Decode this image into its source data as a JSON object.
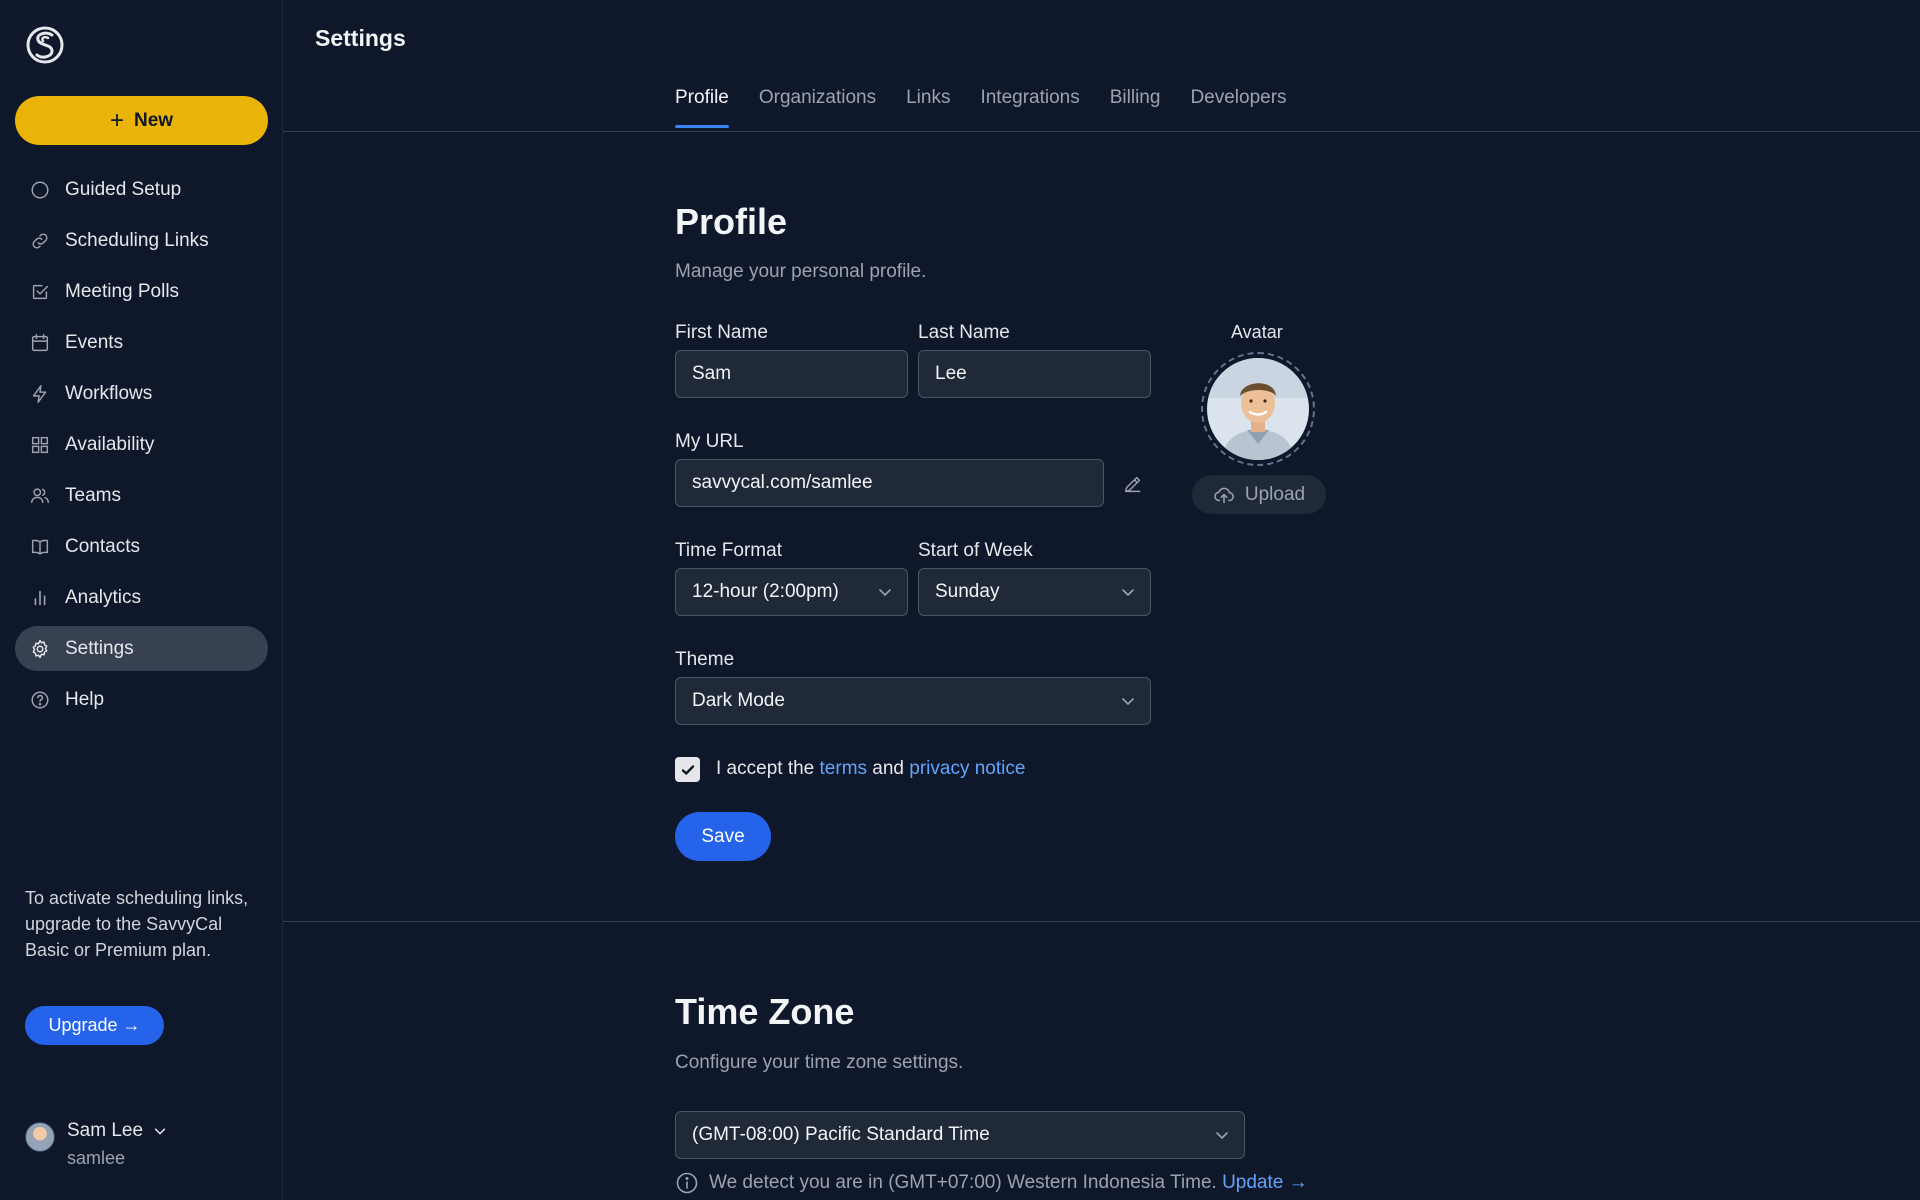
{
  "sidebar": {
    "new_label": "New",
    "items": [
      {
        "label": "Guided Setup",
        "icon": "circle-icon"
      },
      {
        "label": "Scheduling Links",
        "icon": "link-icon"
      },
      {
        "label": "Meeting Polls",
        "icon": "checkbox-icon"
      },
      {
        "label": "Events",
        "icon": "calendar-icon"
      },
      {
        "label": "Workflows",
        "icon": "bolt-icon"
      },
      {
        "label": "Availability",
        "icon": "grid-icon"
      },
      {
        "label": "Teams",
        "icon": "users-icon"
      },
      {
        "label": "Contacts",
        "icon": "book-icon"
      },
      {
        "label": "Analytics",
        "icon": "bar-chart-icon"
      },
      {
        "label": "Settings",
        "icon": "gear-icon",
        "active": true
      },
      {
        "label": "Help",
        "icon": "help-icon"
      }
    ],
    "promo_text": "To activate scheduling links, upgrade to the SavvyCal Basic or Premium plan.",
    "upgrade_label": "Upgrade →",
    "user": {
      "name": "Sam Lee",
      "handle": "samlee"
    }
  },
  "header": {
    "title": "Settings",
    "tabs": [
      {
        "label": "Profile",
        "active": true
      },
      {
        "label": "Organizations"
      },
      {
        "label": "Links"
      },
      {
        "label": "Integrations"
      },
      {
        "label": "Billing"
      },
      {
        "label": "Developers"
      }
    ]
  },
  "profile": {
    "heading": "Profile",
    "subheading": "Manage your personal profile.",
    "first_name_label": "First Name",
    "first_name": "Sam",
    "last_name_label": "Last Name",
    "last_name": "Lee",
    "url_label": "My URL",
    "url": "savvycal.com/samlee",
    "time_format_label": "Time Format",
    "time_format": "12-hour (2:00pm)",
    "start_week_label": "Start of Week",
    "start_week": "Sunday",
    "theme_label": "Theme",
    "theme": "Dark Mode",
    "avatar_label": "Avatar",
    "upload_label": "Upload",
    "accept_prefix": "I accept the",
    "terms": "terms",
    "and": "and",
    "privacy": "privacy notice",
    "save_label": "Save"
  },
  "timezone": {
    "heading": "Time Zone",
    "subheading": "Configure your time zone settings.",
    "selected": "(GMT-08:00) Pacific Standard Time",
    "detect_text": "We detect you are in (GMT+07:00) Western Indonesia Time.",
    "update_label": "Update →"
  },
  "colors": {
    "background": "#0f172a",
    "accent_yellow": "#eab308",
    "primary_blue": "#2563eb",
    "link_blue": "#60a5fa"
  }
}
